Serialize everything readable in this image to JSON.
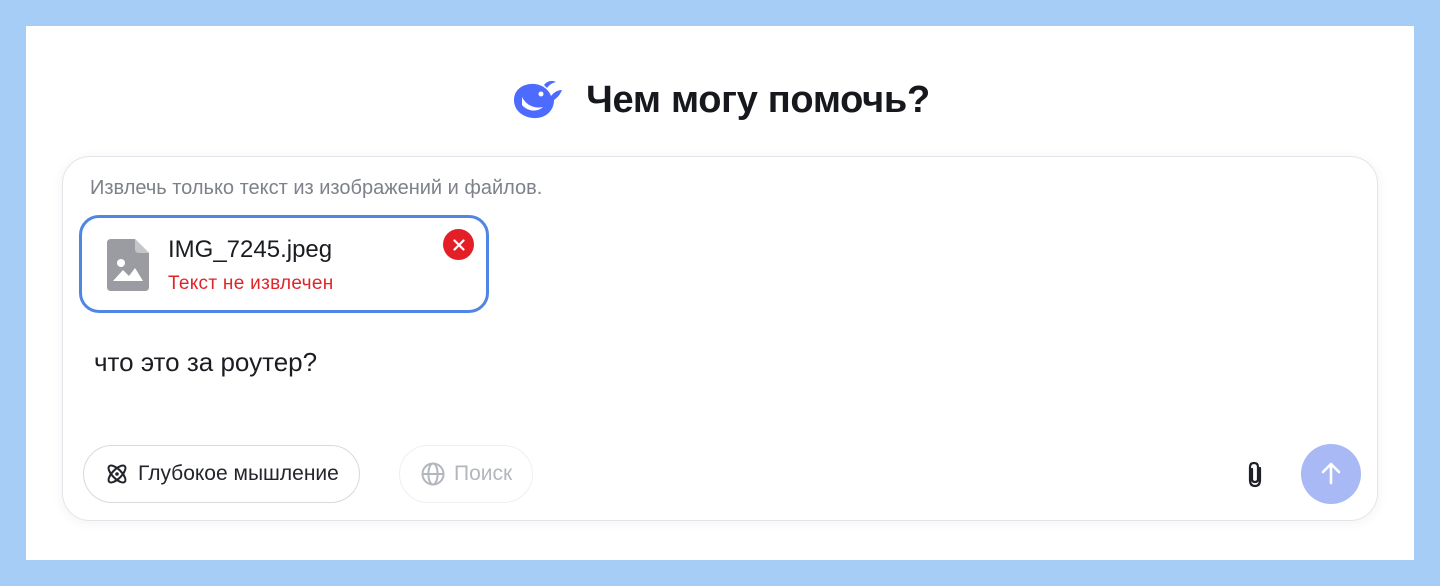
{
  "header": {
    "title": "Чем могу помочь?",
    "logo_icon": "deepseek-whale-icon"
  },
  "composer": {
    "hint": "Извлечь только текст из изображений и файлов.",
    "attachment": {
      "file_name": "IMG_7245.jpeg",
      "status": "Текст не извлечен",
      "file_icon": "image-file-icon",
      "remove_icon": "close-icon"
    },
    "message": "что это за роутер?",
    "toolbar": {
      "deep_think_label": "Глубокое мышление",
      "deep_think_icon": "atom-icon",
      "search_label": "Поиск",
      "search_icon": "globe-icon",
      "attach_icon": "paperclip-icon",
      "send_icon": "arrow-up-icon"
    }
  },
  "colors": {
    "background": "#a5cdf5",
    "brand": "#4d6bfe",
    "error": "#e41e26",
    "card_border": "#4f86e4",
    "send_button": "#a9b9f6"
  }
}
